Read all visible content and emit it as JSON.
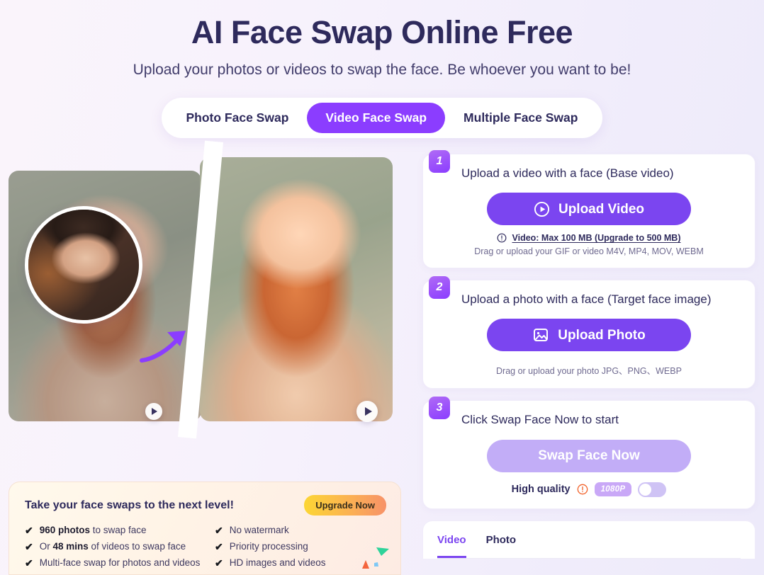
{
  "header": {
    "title": "AI Face Swap Online Free",
    "subtitle": "Upload your photos or videos to swap the face. Be whoever you want to be!"
  },
  "mode_tabs": [
    {
      "label": "Photo Face Swap",
      "active": false
    },
    {
      "label": "Video Face Swap",
      "active": true
    },
    {
      "label": "Multiple Face Swap",
      "active": false
    }
  ],
  "hero": {
    "before_alt": "Original video frame of woman with red hair",
    "after_alt": "Face-swapped result video frame",
    "face_thumb_alt": "Target face image thumbnail",
    "arrow_icon": "curved-arrow-icon",
    "play_icon": "play-icon"
  },
  "promo": {
    "title": "Take your face swaps to the next level!",
    "upgrade_label": "Upgrade Now",
    "features_left": [
      {
        "strong": "960 photos",
        "rest": " to swap face"
      },
      {
        "strong": "48 mins",
        "pre": "Or ",
        "rest": " of videos to swap face"
      },
      {
        "strong": "",
        "rest": "Multi-face swap for photos and videos"
      }
    ],
    "features_right": [
      "No watermark",
      "Priority processing",
      "HD images and videos"
    ],
    "check_glyph": "✔"
  },
  "steps": [
    {
      "number": "1",
      "heading": "Upload a video with a face (Base video)",
      "button_label": "Upload Video",
      "button_icon": "play-circle-icon",
      "note_icon": "info-circle-icon",
      "note_link": "Video: Max 100 MB (Upgrade to 500 MB)",
      "note_sub": "Drag or upload your GIF or video M4V, MP4, MOV, WEBM"
    },
    {
      "number": "2",
      "heading": "Upload a photo with a face (Target face image)",
      "button_label": "Upload Photo",
      "button_icon": "image-icon",
      "note_sub": "Drag or upload your photo JPG、PNG、WEBP"
    },
    {
      "number": "3",
      "heading": "Click Swap Face Now to start",
      "button_label": "Swap Face Now",
      "button_disabled": true,
      "quality_label": "High quality",
      "quality_info_icon": "info-circle-icon",
      "quality_badge": "1080P",
      "quality_toggle_on": false
    }
  ],
  "result_tabs": [
    {
      "label": "Video",
      "active": true
    },
    {
      "label": "Photo",
      "active": false
    }
  ],
  "colors": {
    "accent_purple": "#8B3DFF",
    "cta_purple": "#7B45F0",
    "cta_disabled": "#C2ADF7",
    "title_navy": "#2E2A5C",
    "badge_lilac": "#C9A8F7",
    "upgrade_gradient_start": "#FCD634",
    "upgrade_gradient_end": "#F79268",
    "info_orange": "#F2622A",
    "page_bg_start": "#FAF4FB",
    "page_bg_end": "#EDEAFA"
  }
}
